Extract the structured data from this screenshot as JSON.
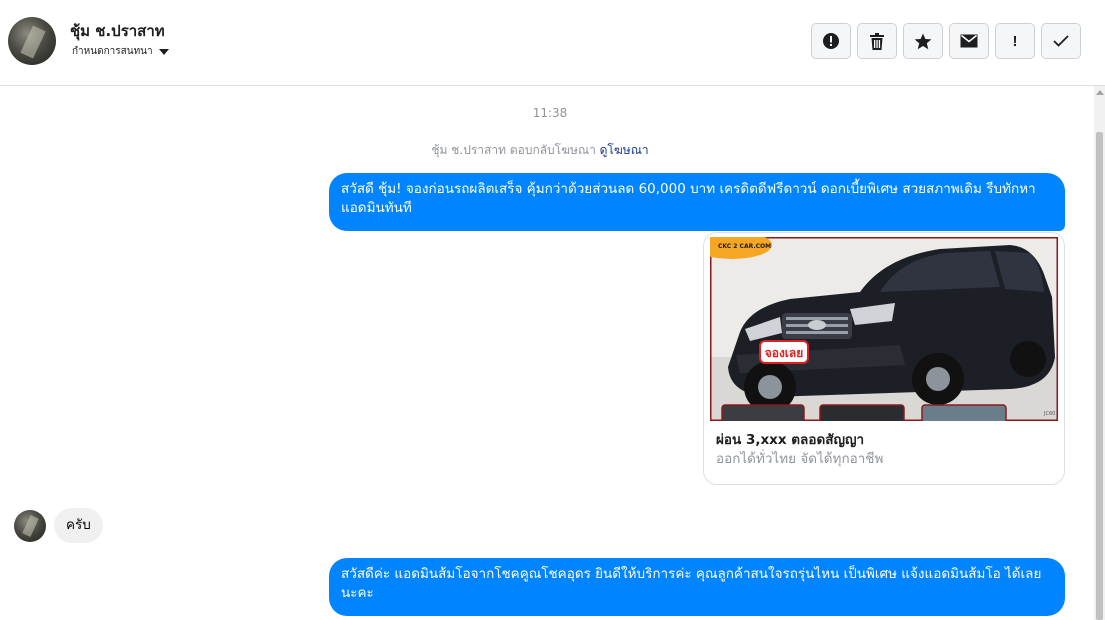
{
  "header": {
    "contact_name": "ชุ้ม ช.ปราสาท",
    "assign_label": "กำหนดการสนทนา"
  },
  "toolbar": {
    "buttons": [
      "alert-circle-icon",
      "trash-icon",
      "star-icon",
      "envelope-icon",
      "exclamation-icon",
      "check-icon"
    ],
    "exclamation_glyph": "!"
  },
  "conversation": {
    "timestamp": "11:38",
    "ad_reply_text": "ชุ้ม ช.ปราสาท ตอบกลับโฆษณา",
    "ad_link": "ดูโฆษณา",
    "messages": [
      {
        "direction": "outgoing",
        "text": "สวัสดี ชุ้ม! จองก่อนรถผลิตเสร็จ คุ้มกว่าด้วยส่วนลด 60,000 บาท เครดิตดีฟรีดาวน์ ดอกเบี้ยพิเศษ สวยสภาพเดิม รีบทักหาแอดมินทันที"
      },
      {
        "direction": "outgoing-card",
        "image_badge": "CKC 2 CAR.COM",
        "image_stamp": "จองเลย",
        "image_code": "JC60",
        "title": "ผ่อน 3,xxx ตลอดสัญญา",
        "subtitle": "ออกได้ทั่วไทย จัดได้ทุกอาชีพ"
      },
      {
        "direction": "incoming",
        "text": "ครับ"
      },
      {
        "direction": "outgoing",
        "text": "สวัสดีค่ะ แอดมินส้มโอจากโชคคูณโชคอุดร ยินดีให้บริการค่ะ   คุณลูกค้าสนใจรถรุ่นไหน เป็นพิเศษ แจ้งแอดมินส้มโอ ได้เลยนะคะ"
      }
    ]
  }
}
